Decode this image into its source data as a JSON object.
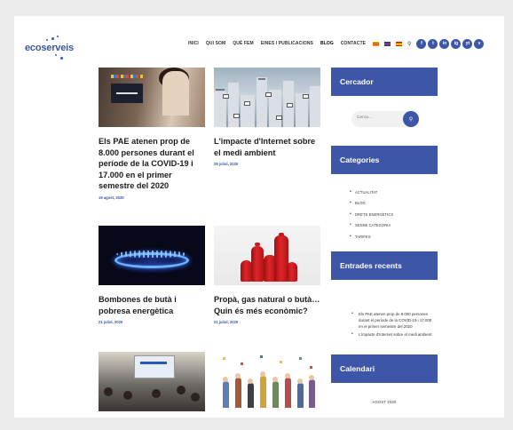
{
  "header": {
    "logo_text": "ecoserveis",
    "nav": [
      "INICI",
      "QUI SOM",
      "QUÈ FEM",
      "EINES I PUBLICACIONS",
      "BLOG",
      "CONTACTE"
    ],
    "social": [
      "f",
      "t",
      "in",
      "ig",
      "yt",
      "v"
    ]
  },
  "posts": [
    {
      "title": "Els PAE atenen prop de 8.000 persones durant el període de la COVID-19 i 17.000 en el primer semestre del 2020",
      "date": "19 agost, 2020"
    },
    {
      "title": "L'impacte d'Internet sobre el medi ambient",
      "date": "28 juliol, 2020"
    },
    {
      "title": "Bombones de butà i pobresa energètica",
      "date": "21 juliol, 2020"
    },
    {
      "title": "Propà, gas natural o butà… Quin és més econòmic?",
      "date": "21 juliol, 2020"
    }
  ],
  "sidebar": {
    "search": {
      "title": "Cercador",
      "placeholder": "Cerca..."
    },
    "categories": {
      "title": "Categories",
      "items": [
        "ACTUALITAT",
        "BLOG",
        "DRETS ENERGÈTICS",
        "SENSE CATEGORIA",
        "TARIFES"
      ]
    },
    "recent": {
      "title": "Entrades recents",
      "items": [
        "Els PAE atenen prop de 8.000 persones durant el període de la COVID-19 i 17.000 en el primer semestre del 2020",
        "L'impacte d'Internet sobre el medi ambient"
      ]
    },
    "calendar": {
      "title": "Calendari",
      "month": "AGOST 2020"
    }
  }
}
